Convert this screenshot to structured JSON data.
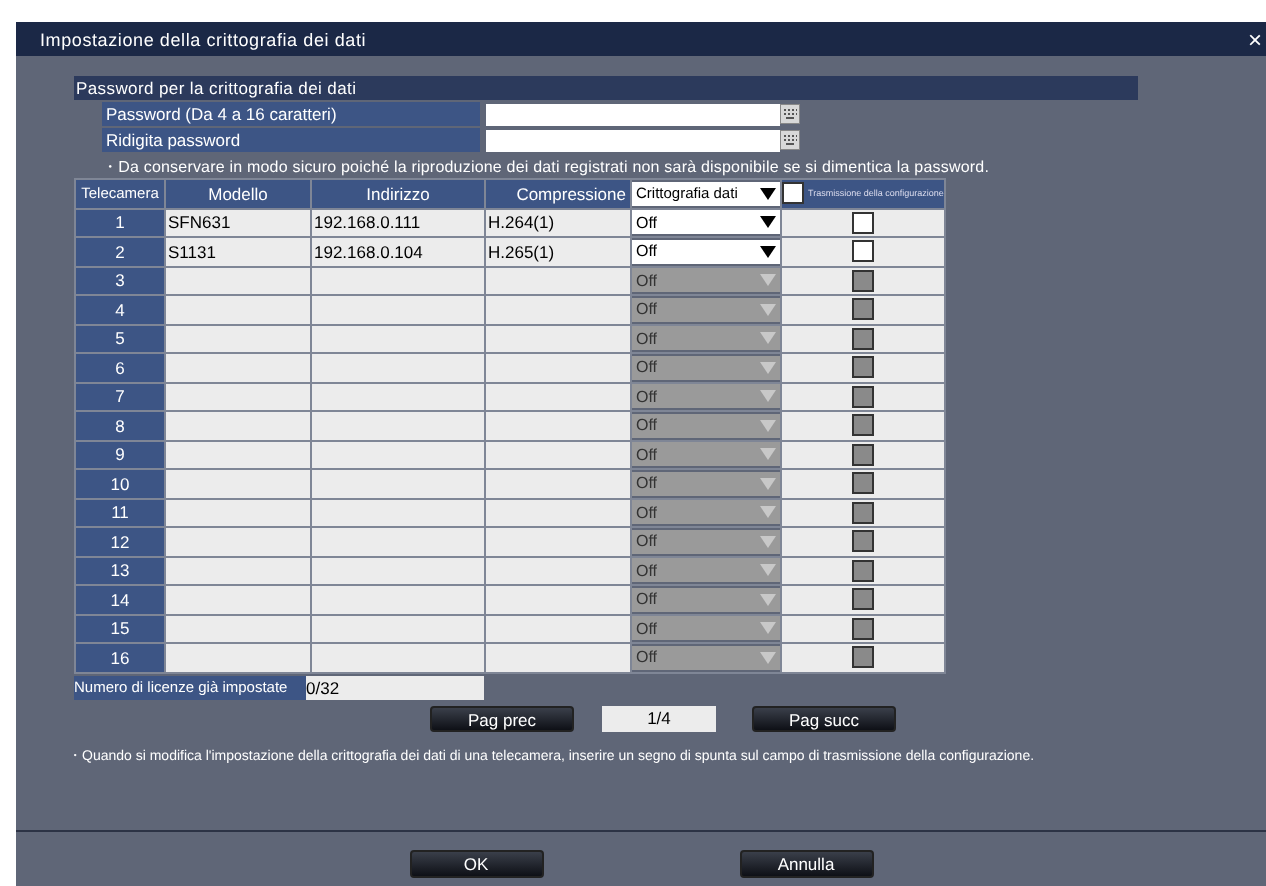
{
  "window": {
    "title": "Impostazione della crittografia dei dati",
    "close": "×"
  },
  "password_section": {
    "title": "Password per la crittografia dei dati",
    "fields": [
      {
        "label": "Password (Da 4 a 16 caratteri)"
      },
      {
        "label": "Ridigita password"
      }
    ],
    "note": "・Da conservare in modo sicuro poiché la riproduzione dei dati registrati non sarà disponibile se si dimentica la password."
  },
  "table": {
    "columns": [
      "Telecamera",
      "Modello",
      "Indirizzo",
      "Compressione"
    ],
    "encryption_header": {
      "value": "Crittografia dati",
      "checked": false
    },
    "transmission_header": "Trasmissione della configurazione",
    "rows": [
      {
        "camera": "1",
        "model": "SFN631",
        "address": "192.168.0.111",
        "compression": "H.264(1)",
        "encryption": "Off",
        "disabled": false,
        "checked": false
      },
      {
        "camera": "2",
        "model": "S1131",
        "address": "192.168.0.104",
        "compression": "H.265(1)",
        "encryption": "Off",
        "disabled": false,
        "checked": false
      },
      {
        "camera": "3",
        "encryption": "Off",
        "disabled": true,
        "checked": false
      },
      {
        "camera": "4",
        "encryption": "Off",
        "disabled": true,
        "checked": false
      },
      {
        "camera": "5",
        "encryption": "Off",
        "disabled": true,
        "checked": false
      },
      {
        "camera": "6",
        "encryption": "Off",
        "disabled": true,
        "checked": false
      },
      {
        "camera": "7",
        "encryption": "Off",
        "disabled": true,
        "checked": false
      },
      {
        "camera": "8",
        "encryption": "Off",
        "disabled": true,
        "checked": false
      },
      {
        "camera": "9",
        "encryption": "Off",
        "disabled": true,
        "checked": false
      },
      {
        "camera": "10",
        "encryption": "Off",
        "disabled": true,
        "checked": false
      },
      {
        "camera": "11",
        "encryption": "Off",
        "disabled": true,
        "checked": false
      },
      {
        "camera": "12",
        "encryption": "Off",
        "disabled": true,
        "checked": false
      },
      {
        "camera": "13",
        "encryption": "Off",
        "disabled": true,
        "checked": false
      },
      {
        "camera": "14",
        "encryption": "Off",
        "disabled": true,
        "checked": false
      },
      {
        "camera": "15",
        "encryption": "Off",
        "disabled": true,
        "checked": false
      },
      {
        "camera": "16",
        "encryption": "Off",
        "disabled": true,
        "checked": false
      }
    ]
  },
  "licenses": {
    "label": "Numero di licenze già impostate",
    "value": "0/32"
  },
  "pager": {
    "prev": "Pag prec",
    "page": "1/4",
    "next": "Pag succ"
  },
  "footer_note": "・Quando si modifica l'impostazione della crittografia dei dati di una telecamera, inserire un segno di spunta sul campo di trasmissione della configurazione.",
  "buttons": [
    "OK",
    "Annulla"
  ]
}
